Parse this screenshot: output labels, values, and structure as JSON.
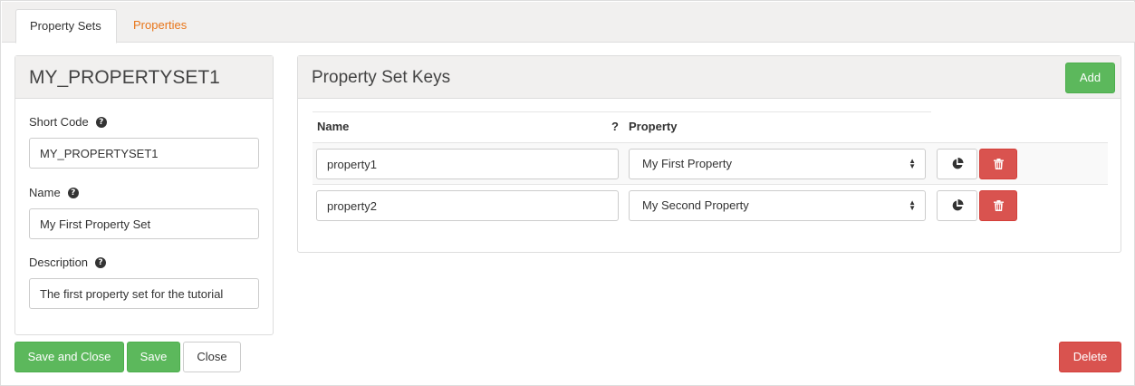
{
  "tabs": [
    {
      "label": "Property Sets",
      "active": true
    },
    {
      "label": "Properties",
      "active": false
    }
  ],
  "left_panel": {
    "title": "MY_PROPERTYSET1",
    "fields": [
      {
        "label": "Short Code",
        "value": "MY_PROPERTYSET1"
      },
      {
        "label": "Name",
        "value": "My First Property Set"
      },
      {
        "label": "Description",
        "value": "The first property set for the tutorial"
      }
    ]
  },
  "right_panel": {
    "title": "Property Set Keys",
    "add_label": "Add",
    "columns": {
      "name": "Name",
      "help": "?",
      "property": "Property"
    },
    "rows": [
      {
        "name": "property1",
        "property": "My First Property"
      },
      {
        "name": "property2",
        "property": "My Second Property"
      }
    ]
  },
  "footer": {
    "save_close_label": "Save and Close",
    "save_label": "Save",
    "close_label": "Close",
    "delete_label": "Delete"
  },
  "colors": {
    "accent_orange": "#e8761b",
    "success": "#5cb85c",
    "danger": "#d9534f",
    "panel_header": "#f1f0ef"
  }
}
